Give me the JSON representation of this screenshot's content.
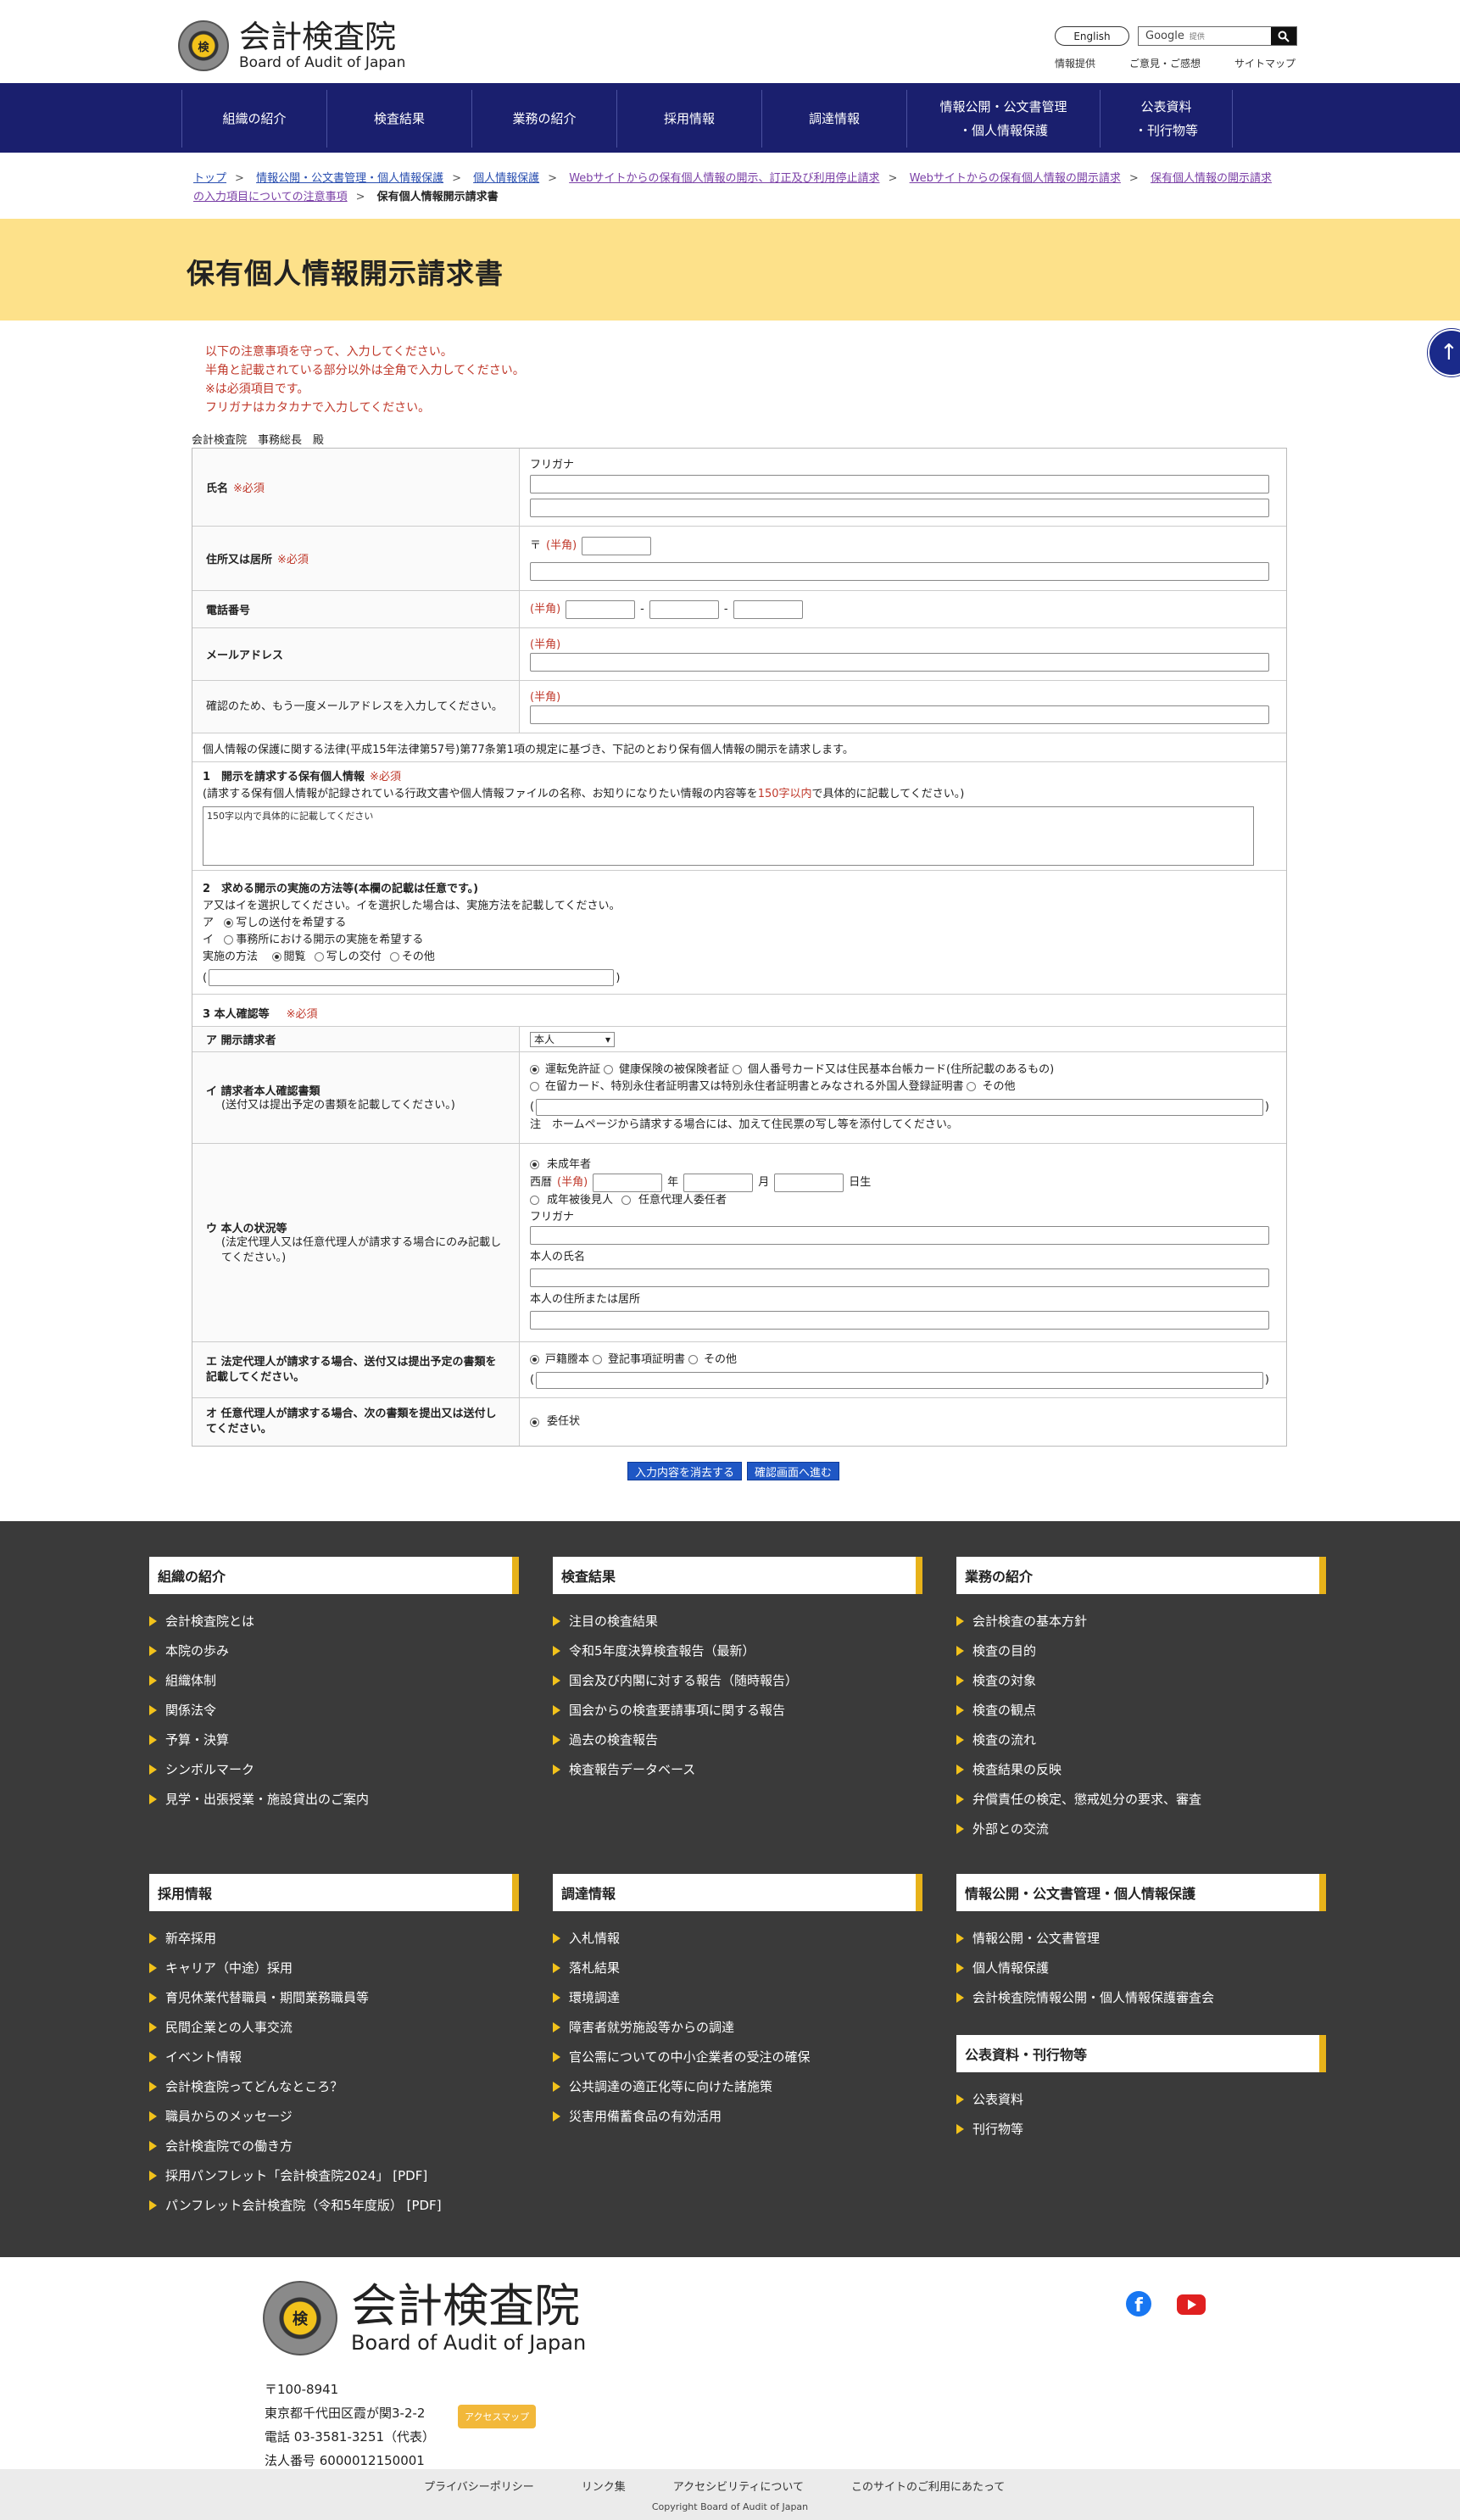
{
  "header": {
    "logo_jp": "会計検査院",
    "logo_en": "Board of Audit of Japan",
    "seal_text": "検",
    "english_button": "English",
    "search_brand": "Google",
    "search_hint": "提供",
    "links": [
      "情報提供",
      "ご意見・ご感想",
      "サイトマップ"
    ]
  },
  "nav": [
    "組織の紹介",
    "検査結果",
    "業務の紹介",
    "採用情報",
    "調達情報",
    "情報公開・公文書管理\n・個人情報保護",
    "公表資料\n・刊行物等"
  ],
  "breadcrumb": {
    "items": [
      "トップ",
      "情報公開・公文書管理・個人情報保護",
      "個人情報保護",
      "Webサイトからの保有個人情報の開示、訂正及び利用停止請求",
      "Webサイトからの保有個人情報の開示請求",
      "保有個人情報の開示請求の入力項目についての注意事項"
    ],
    "current": "保有個人情報開示請求書",
    "sep": ">"
  },
  "page_title": "保有個人情報開示請求書",
  "notes": [
    "以下の注意事項を守って、入力してください。",
    "半角と記載されている部分以外は全角で入力してください。",
    "※は必須項目です。",
    "フリガナはカタカナで入力してください。"
  ],
  "addressee": "会計検査院　事務総長　殿",
  "form": {
    "required": "※必須",
    "half": "(半角)",
    "name_label": "氏名",
    "furigana": "フリガナ",
    "address_label": "住所又は居所",
    "postal_mark": "〒",
    "phone_label": "電話番号",
    "dash": "-",
    "email_label": "メールアドレス",
    "email_confirm_label": "確認のため、もう一度メールアドレスを入力してください。",
    "statement": "個人情報の保護に関する法律(平成15年法律第57号)第77条第1項の規定に基づき、下記のとおり保有個人情報の開示を請求します。",
    "s1_title": "1　開示を請求する保有個人情報",
    "s1_desc_a": "(請求する保有個人情報が記録されている行政文書や個人情報ファイルの名称、お知りになりたい情報の内容等を",
    "s1_desc_b": "150字以内",
    "s1_desc_c": "で具体的に記載してください。)",
    "s1_placeholder": "150字以内で具体的に記載してください",
    "s2_title": "2　求める開示の実施の方法等(本欄の記載は任意です。)",
    "s2_desc": "ア又はイを選択してください。イを選択した場合は、実施方法を記載してください。",
    "s2_opt_a_mark": "ア",
    "s2_opt_a": "写しの送付を希望する",
    "s2_opt_b_mark": "イ",
    "s2_opt_b": "事務所における開示の実施を希望する",
    "s2_method_label": "実施の方法",
    "s2_methods": [
      "閲覧",
      "写しの交付",
      "その他"
    ],
    "paren_open": "(",
    "paren_close": ")",
    "s3_title": "3 本人確認等",
    "a_label": "ア 開示請求者",
    "a_value": "本人",
    "a_arrow": "▾",
    "i_label": "イ 請求者本人確認書類",
    "i_sub": "(送付又は提出予定の書類を記載してください。)",
    "i_opts_1": [
      "運転免許証",
      "健康保険の被保険者証",
      "個人番号カード又は住民基本台帳カード(住所記載のあるもの)"
    ],
    "i_opts_2": [
      "在留カード、特別永住者証明書又は特別永住者証明書とみなされる外国人登録証明書",
      "その他"
    ],
    "i_note": "注　ホームページから請求する場合には、加えて住民票の写し等を添付してください。",
    "u_label": "ウ 本人の状況等",
    "u_sub": "(法定代理人又は任意代理人が請求する場合にのみ記載してください。)",
    "u_minor": "未成年者",
    "u_era": "西暦",
    "u_year": "年",
    "u_month": "月",
    "u_day": "日生",
    "u_opts": [
      "成年被後見人",
      "任意代理人委任者"
    ],
    "u_furigana": "フリガナ",
    "u_name": "本人の氏名",
    "u_address": "本人の住所または居所",
    "e_label": "エ 法定代理人が請求する場合、送付又は提出予定の書類を記載してください。",
    "e_opts": [
      "戸籍謄本",
      "登記事項証明書",
      "その他"
    ],
    "o_label": "オ 任意代理人が請求する場合、次の書類を提出又は送付してください。",
    "o_value": "委任状"
  },
  "buttons": {
    "clear": "入力内容を消去する",
    "confirm": "確認画面へ進む"
  },
  "footer": {
    "columns": [
      {
        "title": "組織の紹介",
        "items": [
          "会計検査院とは",
          "本院の歩み",
          "組織体制",
          "関係法令",
          "予算・決算",
          "シンボルマーク",
          "見学・出張授業・施設貸出のご案内"
        ]
      },
      {
        "title": "検査結果",
        "items": [
          "注目の検査結果",
          "令和5年度決算検査報告（最新）",
          "国会及び内閣に対する報告（随時報告）",
          "国会からの検査要請事項に関する報告",
          "過去の検査報告",
          "検査報告データベース"
        ]
      },
      {
        "title": "業務の紹介",
        "items": [
          "会計検査の基本方針",
          "検査の目的",
          "検査の対象",
          "検査の観点",
          "検査の流れ",
          "検査結果の反映",
          "弁償責任の検定、懲戒処分の要求、審査",
          "外部との交流"
        ]
      },
      {
        "title": "採用情報",
        "items": [
          "新卒採用",
          "キャリア（中途）採用",
          "育児休業代替職員・期間業務職員等",
          "民間企業との人事交流",
          "イベント情報",
          "会計検査院ってどんなところ？",
          "職員からのメッセージ",
          "会計検査院での働き方",
          "採用パンフレット「会計検査院2024」 [PDF]",
          "パンフレット会計検査院（令和5年度版） [PDF]"
        ]
      },
      {
        "title": "調達情報",
        "items": [
          "入札情報",
          "落札結果",
          "環境調達",
          "障害者就労施設等からの調達",
          "官公需についての中小企業者の受注の確保",
          "公共調達の適正化等に向けた諸施策",
          "災害用備蓄食品の有効活用"
        ]
      },
      {
        "title": "情報公開・公文書管理・個人情報保護",
        "items": [
          "情報公開・公文書管理",
          "個人情報保護",
          "会計検査院情報公開・個人情報保護審査会"
        ]
      },
      {
        "title": "公表資料・刊行物等",
        "items": [
          "公表資料",
          "刊行物等"
        ]
      }
    ],
    "address": [
      "〒100-8941",
      "東京都千代田区霞が関3-2-2",
      "電話 03-3581-3251（代表）",
      "法人番号 6000012150001"
    ],
    "access_map": "アクセスマップ",
    "facebook": "f",
    "bottom_links": [
      "プライバシーポリシー",
      "リンク集",
      "アクセシビリティについて",
      "このサイトのご利用にあたって"
    ],
    "copyright": "Copyright Board of Audit of Japan"
  },
  "colors": {
    "nav": "#1a1f6e",
    "title_band": "#fde18a",
    "accent": "#e7b21a",
    "required": "#c0392b",
    "footer": "#3a3a3a"
  }
}
